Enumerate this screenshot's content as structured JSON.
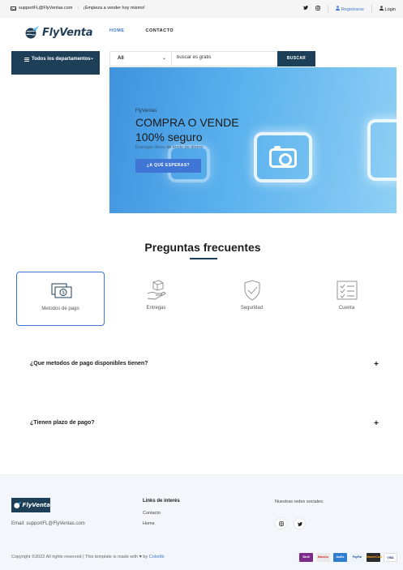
{
  "topbar": {
    "email": "supportFL@FlyVentas.com",
    "tagline": "¡Empieza a vender hoy mismo!",
    "register": "Registrarse",
    "login": "Login"
  },
  "header": {
    "logo_text": "FlyVenta",
    "nav": {
      "home": "HOME",
      "contact": "CONTACTO"
    }
  },
  "departments": {
    "label": "Todos los departamentos"
  },
  "search": {
    "category": "All",
    "placeholder": "buscar es gratis",
    "button": "BUSCAR"
  },
  "hero": {
    "brand": "FlyVentas",
    "headline_1": "COMPRA O VENDE",
    "headline_2": "100% seguro",
    "subtitle": "Entregas libres de envio de dinero",
    "cta": "¿A QUÉ ESPERAS?"
  },
  "faq": {
    "title": "Preguntas frecuentes",
    "categories": [
      {
        "label": "Metodos de pago",
        "icon": "money-icon",
        "active": true
      },
      {
        "label": "Entregas",
        "icon": "delivery-box-icon",
        "active": false
      },
      {
        "label": "Seguridad",
        "icon": "shield-icon",
        "active": false
      },
      {
        "label": "Cuenta",
        "icon": "checklist-icon",
        "active": false
      }
    ],
    "questions": [
      "¿Que metodos de pago disponibles tienen?",
      "¿Tienen plazo de pago?"
    ],
    "toggle": "+"
  },
  "footer": {
    "logo_text": "FlyVenta",
    "email": "Email: supportFL@FlyVentas.com",
    "links_title": "Links de interés",
    "links": [
      "Contacto",
      "Home"
    ],
    "social_title": "Nuestras redes sociales:",
    "copyright_prefix": "Copyright ©2022 All rights reserved | This template is made with",
    "copyright_by": "by",
    "copyright_link": "Colorlib",
    "payments": [
      "Skrill",
      "Maestro",
      "AmEx",
      "PayPal",
      "MasterCard",
      "VISA"
    ]
  },
  "colors": {
    "primary_dark": "#1d3f57",
    "accent_blue": "#3f76d6",
    "footer_bg": "#f3f6fa"
  }
}
